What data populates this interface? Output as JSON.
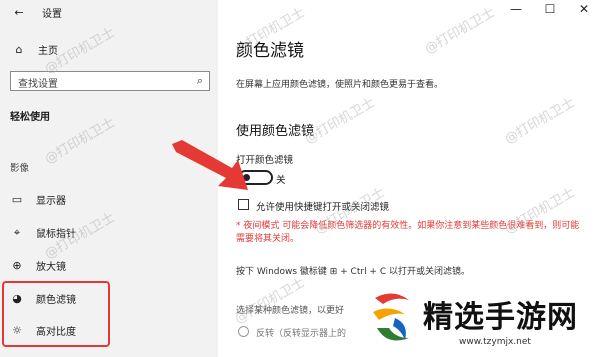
{
  "window": {
    "title": "设置",
    "controls": [
      "—",
      "☐",
      "✕"
    ]
  },
  "sidebar": {
    "home_label": "主页",
    "search_placeholder": "查找设置",
    "section_title": "轻松使用",
    "group_label": "影像",
    "items": [
      {
        "label": "显示器",
        "icon": "monitor-icon"
      },
      {
        "label": "鼠标指针",
        "icon": "pointer-icon"
      },
      {
        "label": "放大镜",
        "icon": "magnifier-icon"
      },
      {
        "label": "颜色滤镜",
        "icon": "palette-icon"
      },
      {
        "label": "高对比度",
        "icon": "contrast-icon"
      }
    ]
  },
  "main": {
    "title": "颜色滤镜",
    "description": "在屏幕上应用颜色滤镜，使照片和颜色更易于查看。",
    "section_title": "使用颜色滤镜",
    "toggle_label": "打开颜色滤镜",
    "toggle_state": "关",
    "toggle_on": false,
    "checkbox_label": "允许使用快捷键打开或关闭滤镜",
    "note": "* 夜间模式 可能会降低颜色筛选器的有效性。如果你注意到某些颜色很难看到，则可能需要将其关闭。",
    "shortcut_text": "按下 Windows 徽标键 ⊞ + Ctrl + C 以打开或关闭滤镜。",
    "select_text": "选择某种颜色滤镜，以更好",
    "radio_label": "反转（反转显示器上的"
  },
  "watermark": "@打印机卫士",
  "promo": {
    "brand": "精选手游网",
    "url": "www.tzymjx.net"
  },
  "colors": {
    "accent": "#e53935",
    "sidebar_bg": "#f2f2f2"
  }
}
